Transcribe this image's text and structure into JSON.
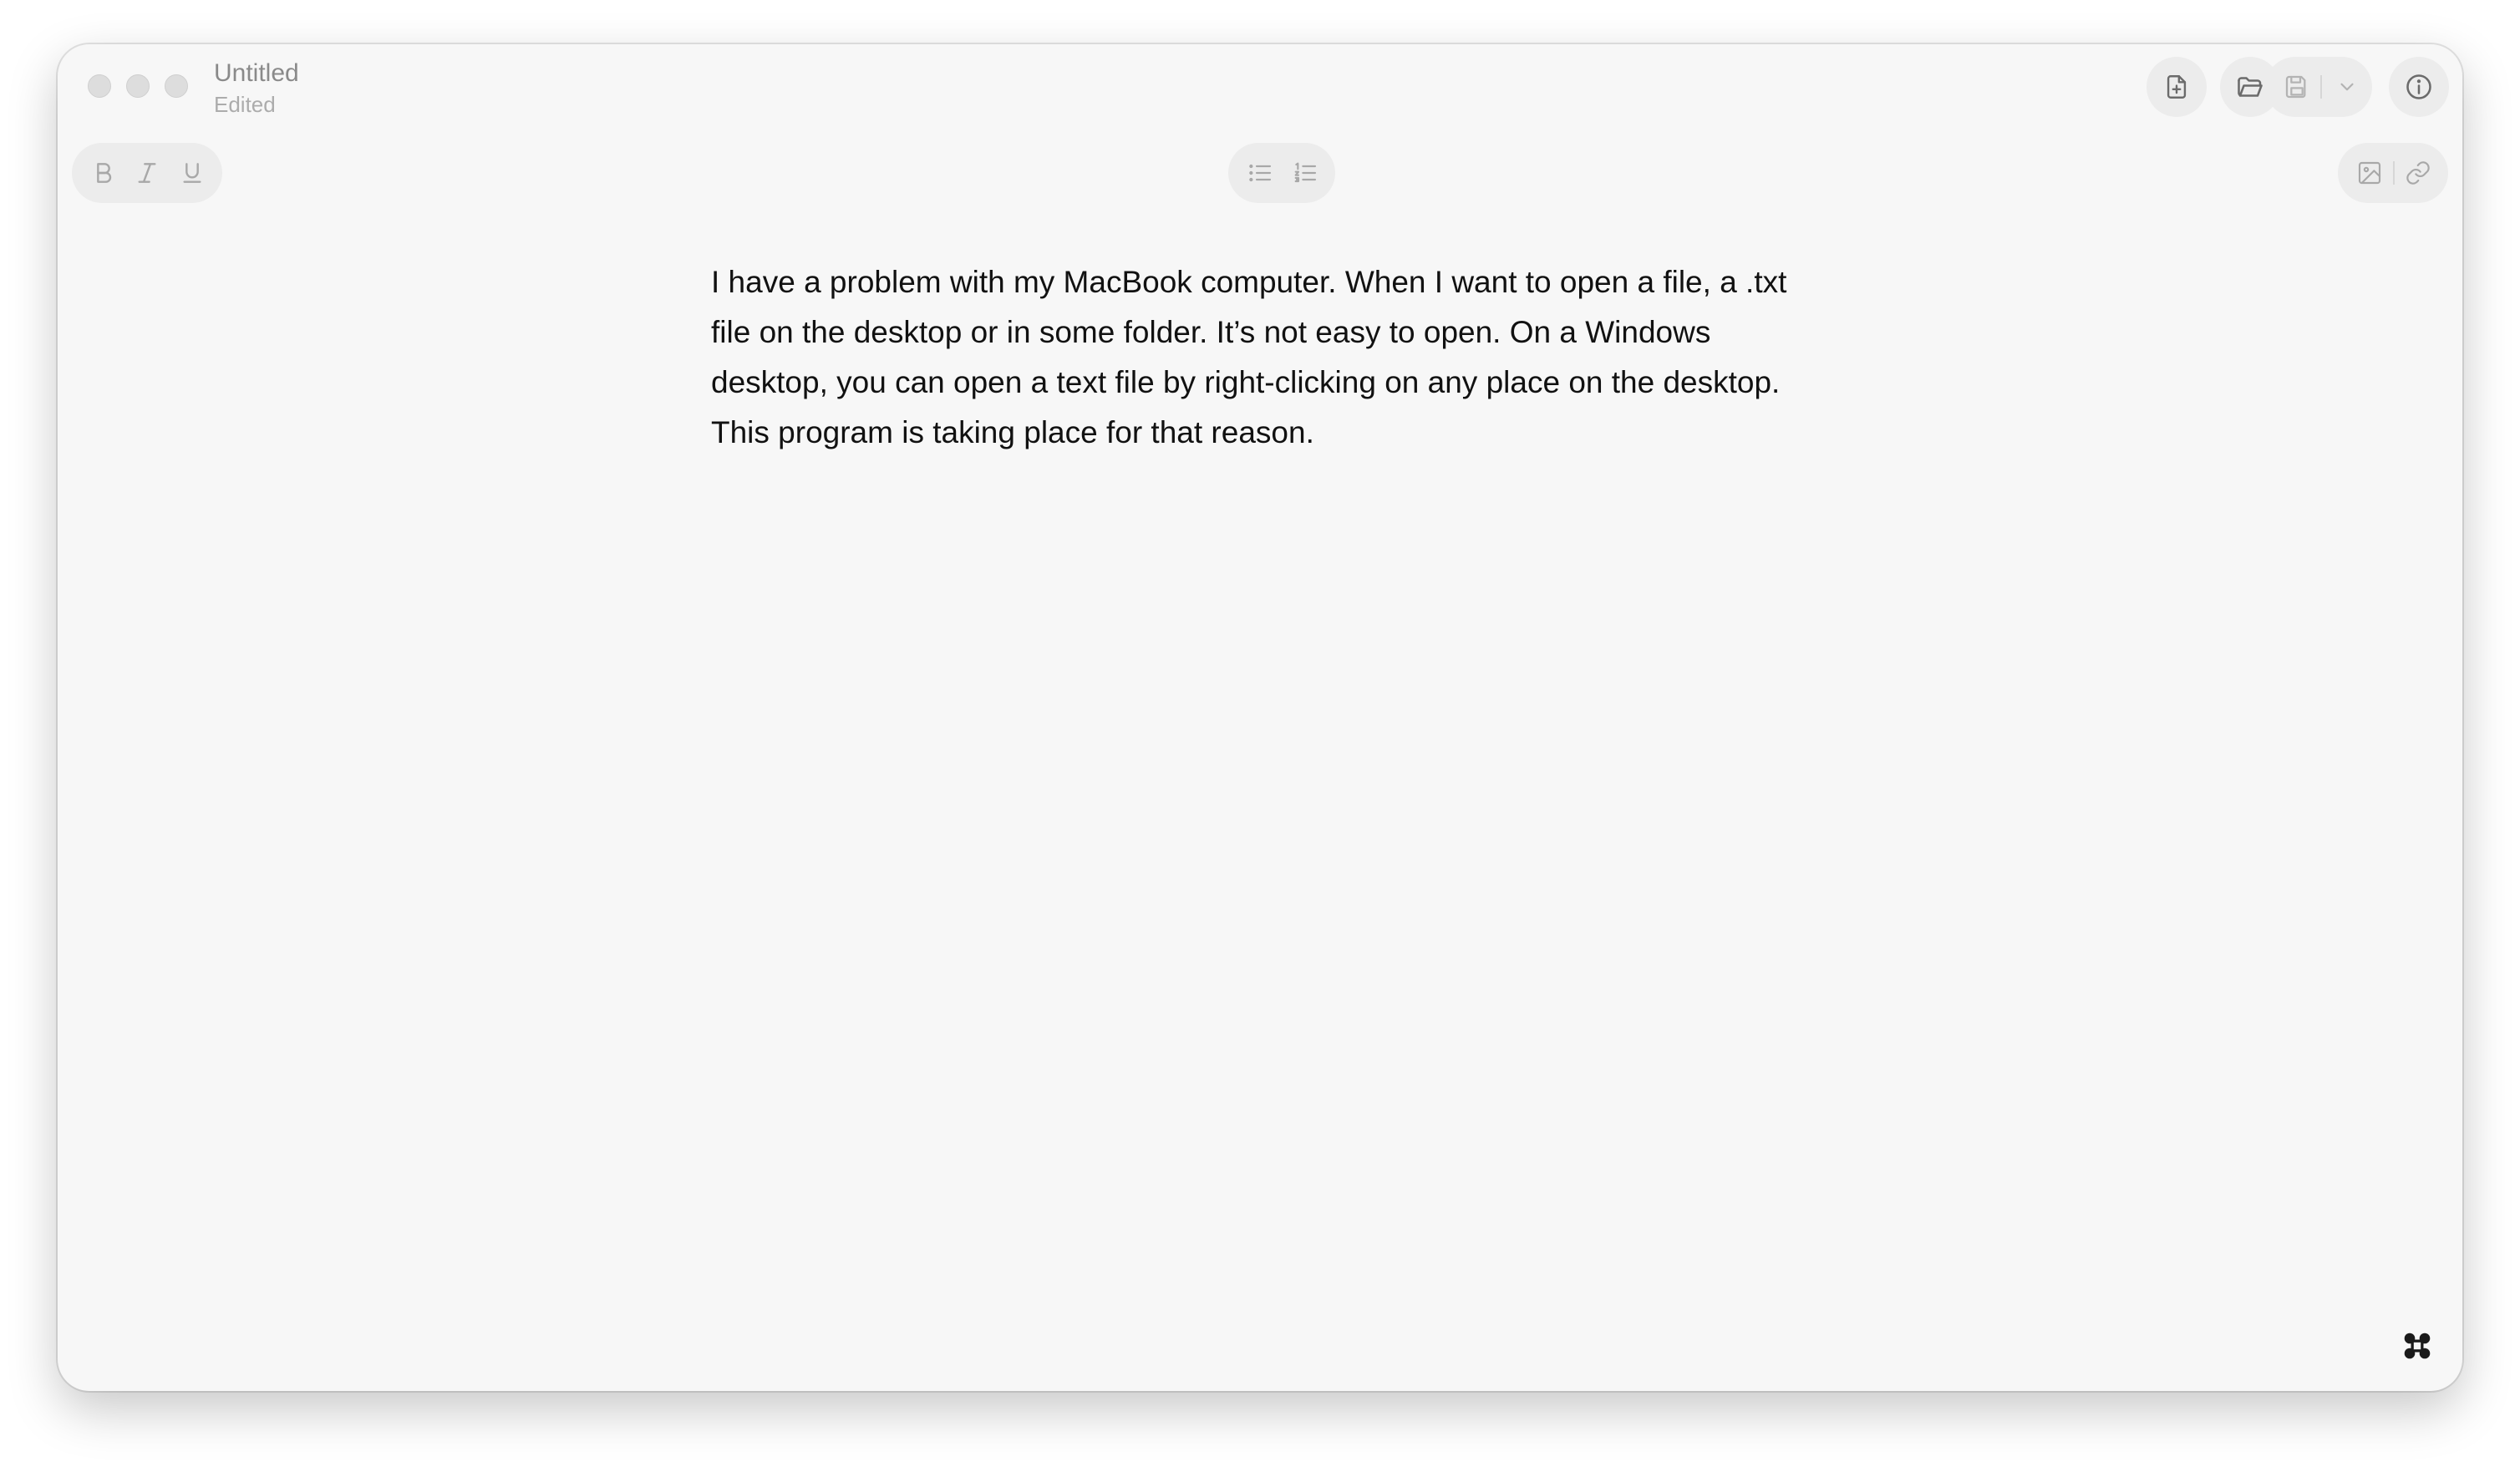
{
  "window": {
    "title": "Untitled",
    "status": "Edited"
  },
  "toolbar": {
    "left_group": [
      {
        "icon": "bold-icon",
        "label": "B"
      },
      {
        "icon": "italic-icon",
        "label": "I"
      },
      {
        "icon": "underline-icon",
        "label": "U"
      }
    ],
    "center_group": [
      {
        "icon": "bulleted-list-icon"
      },
      {
        "icon": "numbered-list-icon"
      }
    ],
    "right_group": [
      {
        "icon": "insert-image-icon"
      },
      {
        "icon": "insert-link-icon"
      }
    ],
    "titlebar_buttons": [
      {
        "icon": "new-document-icon"
      },
      {
        "icon": "open-folder-icon"
      },
      {
        "icon": "save-icon"
      },
      {
        "icon": "chevron-down-icon"
      },
      {
        "icon": "info-icon"
      }
    ]
  },
  "document": {
    "text": "I have a problem with my MacBook computer. When I want to open a file, a .txt file on the desktop or in some folder. It’s not easy to open. On a Windows desktop, you can open a text file by right-clicking on any place on the desktop. This program is taking place for that reason."
  },
  "colors": {
    "window_bg": "#f7f7f7",
    "pill_bg": "#ececec",
    "text": "#111111",
    "muted": "#8a8a8a"
  }
}
